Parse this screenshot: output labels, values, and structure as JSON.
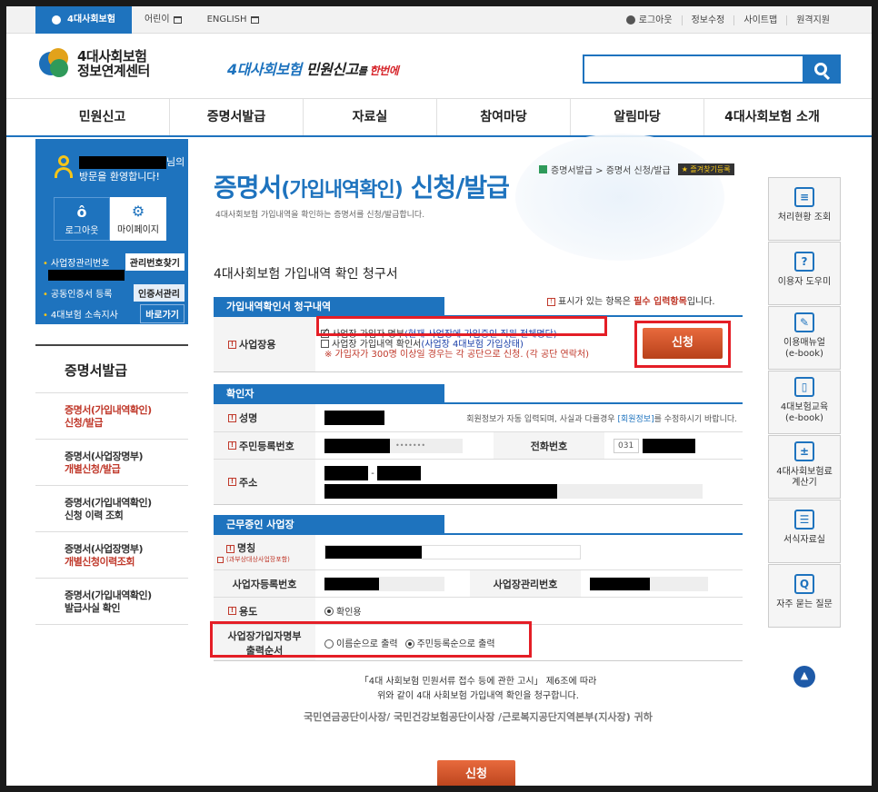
{
  "topbar": {
    "tabs": [
      "4대사회보험",
      "어린이",
      "ENGLISH"
    ],
    "links": [
      "로그아웃",
      "정보수정",
      "사이트맵",
      "원격지원"
    ]
  },
  "header": {
    "logo_line1": "4대사회보험",
    "logo_line2": "정보연계센터",
    "slogan_blue": "4대사회보험",
    "slogan_black": " 민원신고",
    "slogan_small": "를 ",
    "slogan_red": "한번에",
    "search_placeholder": ""
  },
  "gnb": [
    "민원신고",
    "증명서발급",
    "자료실",
    "참여마당",
    "알림마당",
    "4대사회보험 소개"
  ],
  "left": {
    "greeting_suffix": "님의",
    "greeting_line2": "방문을 환영합니다!",
    "logout": "로그아웃",
    "mypage": "마이페이지",
    "rows": [
      {
        "label": "사업장관리번호",
        "button": "관리번호찾기"
      },
      {
        "label": "공동인증서 등록",
        "button": "인증서관리"
      },
      {
        "label": "4대보험 소속지사",
        "button": "바로가기"
      }
    ],
    "menu_title": "증명서발급",
    "menu": [
      {
        "line1": "증명서(가입내역확인)",
        "line2": "신청/발급",
        "active": true
      },
      {
        "line1": "증명서(사업장명부)",
        "line2": "개별신청/발급",
        "active": false
      },
      {
        "line1": "증명서(가입내역확인)",
        "line2": "신청 이력 조회",
        "active": false
      },
      {
        "line1": "증명서(사업장명부)",
        "line2": "개별신청이력조회",
        "active": false
      },
      {
        "line1": "증명서(가입내역확인)",
        "line2": "발급사실 확인",
        "active": false
      }
    ]
  },
  "content": {
    "breadcrumb": "증명서발급 > 증명서 신청/발급",
    "fav": "즐겨찾기등록",
    "title_main": "증명서",
    "title_paren": "(가입내역확인)",
    "title_tail": " 신청/발급",
    "desc": "4대사회보험 가입내역을 확인하는 증명서를 신청/발급합니다.",
    "section_title": "4대사회보험 가입내역 확인 청구서",
    "req_note_pre": "표시가 있는 항목은 ",
    "req_note_red": "필수 입력항목",
    "req_note_post": "입니다.",
    "tab1": "가입내역확인서 청구내역",
    "usage_label": "사업장용",
    "opt1": "사업장 가입자 명부",
    "opt1_note": "(현재 사업장에 가입중인 직원 전체명단)",
    "opt2": "사업장 가입내역 확인서",
    "opt2_note": "(사업장 4대보험 가입상태)",
    "opt2_warn": "※ 가입자가 300명 이상일 경우는 각 공단으로 신청. (각 공단 연락처)",
    "apply": "신청",
    "tab2": "확인자",
    "name_label": "성명",
    "name_note_pre": "회원정보가 자동 입력되며, 사실과 다를경우 ",
    "name_note_link": "[회원정보]",
    "name_note_post": "를 수정하시기 바랍니다.",
    "rrn_label": "주민등록번호",
    "rrn_mask": "•••••••",
    "phone_label": "전화번호",
    "phone_prefix": "031",
    "addr_label": "주소",
    "addr_dash": "-",
    "tab3": "근무중인 사업장",
    "biz_name_label": "명칭",
    "biz_name_sub": "(과부상대상사업장포함)",
    "biz_no_label": "사업자등록번호",
    "mgmt_no_label": "사업장관리번호",
    "purpose_label": "용도",
    "purpose_value": "확인용",
    "order_label_1": "사업장가입자명부",
    "order_label_2": "출력순서",
    "order_opt1": "이름순으로 출력",
    "order_opt2": "주민등록순으로 출력",
    "footer1": "「4대 사회보험 민원서류 접수 등에 관한 고시」 제6조에 따라",
    "footer2": "위와 같이 4대 사회보험 가입내역 확인을 청구합니다.",
    "footer_org": "국민연금공단이사장/ 국민건강보험공단이사장 /근로복지공단지역본부(지사장) 귀하"
  },
  "quick": [
    {
      "label": "처리현황 조회",
      "icon": "clipboard-search-icon",
      "glyph": "≡"
    },
    {
      "label": "이용자 도우미",
      "icon": "monitor-help-icon",
      "glyph": "?"
    },
    {
      "label": "이용매뉴얼\n(e-book)",
      "icon": "manual-edit-icon",
      "glyph": "✎"
    },
    {
      "label": "4대보험교육\n(e-book)",
      "icon": "book-icon",
      "glyph": "▯"
    },
    {
      "label": "4대사회보험료\n계산기",
      "icon": "calculator-icon",
      "glyph": "±"
    },
    {
      "label": "서식자료실",
      "icon": "document-list-icon",
      "glyph": "☰"
    },
    {
      "label": "자주 묻는 질문",
      "icon": "faq-bubble-icon",
      "glyph": "Q"
    }
  ],
  "colors": {
    "brand_blue": "#1e73be",
    "highlight_red": "#e41e26",
    "apply_orange": "#c94c20"
  }
}
